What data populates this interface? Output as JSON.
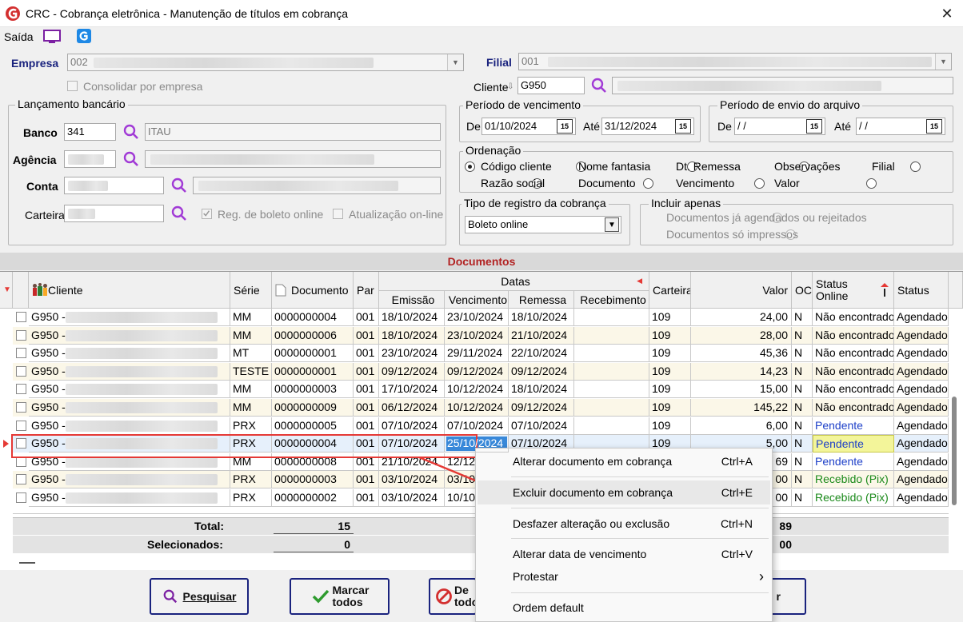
{
  "window": {
    "title": "CRC - Cobrança eletrônica - Manutenção de títulos em cobrança",
    "close": "✕"
  },
  "menu": {
    "saida": "Saída"
  },
  "empresa": {
    "label": "Empresa",
    "code": "002",
    "consolidar": "Consolidar por empresa"
  },
  "filial": {
    "label": "Filial",
    "code": "001"
  },
  "cliente": {
    "label": "Cliente",
    "code": "G950"
  },
  "lancamento": {
    "title": "Lançamento bancário",
    "banco_label": "Banco",
    "banco": "341",
    "banco_nome": "ITAU",
    "agencia_label": "Agência",
    "conta_label": "Conta",
    "carteira_label": "Carteira",
    "reg_boleto": "Reg. de boleto online",
    "atualizacao": "Atualização on-line"
  },
  "vencimento": {
    "title": "Período de vencimento",
    "de_label": "De",
    "de": "01/10/2024",
    "ate_label": "Até",
    "ate": "31/12/2024"
  },
  "envio": {
    "title": "Período de envio do arquivo",
    "de_label": "De",
    "de": " / /",
    "ate_label": "Até",
    "ate": " / /"
  },
  "ordenacao": {
    "title": "Ordenação",
    "opts": [
      "Código cliente",
      "Nome fantasia",
      "Dt. Remessa",
      "Observações",
      "Filial",
      "Razão social",
      "Documento",
      "Vencimento",
      "Valor"
    ]
  },
  "tipo": {
    "title": "Tipo de registro da cobrança",
    "value": "Boleto online"
  },
  "incluir": {
    "title": "Incluir apenas",
    "opt1": "Documentos já agendados ou rejeitados",
    "opt2": "Documentos só impressos"
  },
  "documentos": {
    "title": "Documentos"
  },
  "grid": {
    "h_cliente": "Cliente",
    "h_serie": "Série",
    "h_documento": "Documento",
    "h_par": "Par",
    "h_datas": "Datas",
    "h_emissao": "Emissão",
    "h_vencimento": "Vencimento",
    "h_remessa": "Remessa",
    "h_recebimento": "Recebimento",
    "h_carteira": "Carteira",
    "h_valor": "Valor",
    "h_oc": "OC",
    "h_status_online": "Status Online",
    "h_status": "Status",
    "rows": [
      {
        "cliente": "G950 -",
        "serie": "MM",
        "doc": "0000000004",
        "par": "001",
        "emissao": "18/10/2024",
        "venc": "23/10/2024",
        "remessa": "18/10/2024",
        "receb": "",
        "carteira": "109",
        "valor": "24,00",
        "oc": "N",
        "status_online": "Não encontrado",
        "status": "Agendado"
      },
      {
        "cliente": "G950 -",
        "serie": "MM",
        "doc": "0000000006",
        "par": "001",
        "emissao": "18/10/2024",
        "venc": "23/10/2024",
        "remessa": "21/10/2024",
        "receb": "",
        "carteira": "109",
        "valor": "28,00",
        "oc": "N",
        "status_online": "Não encontrado",
        "status": "Agendado"
      },
      {
        "cliente": "G950 -",
        "serie": "MT",
        "doc": "0000000001",
        "par": "001",
        "emissao": "23/10/2024",
        "venc": "29/11/2024",
        "remessa": "22/10/2024",
        "receb": "",
        "carteira": "109",
        "valor": "45,36",
        "oc": "N",
        "status_online": "Não encontrado",
        "status": "Agendado"
      },
      {
        "cliente": "G950 -",
        "serie": "TESTE",
        "doc": "0000000001",
        "par": "001",
        "emissao": "09/12/2024",
        "venc": "09/12/2024",
        "remessa": "09/12/2024",
        "receb": "",
        "carteira": "109",
        "valor": "14,23",
        "oc": "N",
        "status_online": "Não encontrado",
        "status": "Agendado"
      },
      {
        "cliente": "G950 -",
        "serie": "MM",
        "doc": "0000000003",
        "par": "001",
        "emissao": "17/10/2024",
        "venc": "10/12/2024",
        "remessa": "18/10/2024",
        "receb": "",
        "carteira": "109",
        "valor": "15,00",
        "oc": "N",
        "status_online": "Não encontrado",
        "status": "Agendado"
      },
      {
        "cliente": "G950 -",
        "serie": "MM",
        "doc": "0000000009",
        "par": "001",
        "emissao": "06/12/2024",
        "venc": "10/12/2024",
        "remessa": "09/12/2024",
        "receb": "",
        "carteira": "109",
        "valor": "145,22",
        "oc": "N",
        "status_online": "Não encontrado",
        "status": "Agendado"
      },
      {
        "cliente": "G950 -",
        "serie": "PRX",
        "doc": "0000000005",
        "par": "001",
        "emissao": "07/10/2024",
        "venc": "07/10/2024",
        "remessa": "07/10/2024",
        "receb": "",
        "carteira": "109",
        "valor": "6,00",
        "oc": "N",
        "status_online": "Pendente",
        "status": "Agendado"
      },
      {
        "cliente": "G950 -",
        "serie": "PRX",
        "doc": "0000000004",
        "par": "001",
        "emissao": "07/10/2024",
        "venc": "25/10/2024",
        "remessa": "07/10/2024",
        "receb": "",
        "carteira": "109",
        "valor": "5,00",
        "oc": "N",
        "status_online": "Pendente",
        "status": "Agendado"
      },
      {
        "cliente": "G950 -",
        "serie": "MM",
        "doc": "0000000008",
        "par": "001",
        "emissao": "21/10/2024",
        "venc": "12/12",
        "remessa": "",
        "receb": "",
        "carteira": "",
        "valor": "69",
        "oc": "N",
        "status_online": "Pendente",
        "status": "Agendado"
      },
      {
        "cliente": "G950 -",
        "serie": "PRX",
        "doc": "0000000003",
        "par": "001",
        "emissao": "03/10/2024",
        "venc": "03/10",
        "remessa": "",
        "receb": "",
        "carteira": "",
        "valor": "00",
        "oc": "N",
        "status_online": "Recebido (Pix)",
        "status": "Agendado"
      },
      {
        "cliente": "G950 -",
        "serie": "PRX",
        "doc": "0000000002",
        "par": "001",
        "emissao": "03/10/2024",
        "venc": "10/10",
        "remessa": "",
        "receb": "",
        "carteira": "",
        "valor": "00",
        "oc": "N",
        "status_online": "Recebido (Pix)",
        "status": "Agendado"
      }
    ],
    "total_label": "Total:",
    "total": "15",
    "total_valor": "89",
    "selecionados_label": "Selecionados:",
    "selecionados": "0",
    "sel_valor": "00"
  },
  "buttons": {
    "pesquisar": "Pesquisar",
    "marcar": "Marcar todos",
    "desmarcar": "De todo",
    "r": "r"
  },
  "context_menu": {
    "alterar": "Alterar documento em cobrança",
    "alterar_sc": "Ctrl+A",
    "excluir": "Excluir documento em cobrança",
    "excluir_sc": "Ctrl+E",
    "desfazer": "Desfazer alteração ou exclusão",
    "desfazer_sc": "Ctrl+N",
    "alterar_data": "Alterar data de vencimento",
    "alterar_data_sc": "Ctrl+V",
    "protestar": "Protestar",
    "protestar_arrow": "›",
    "ordem": "Ordem default"
  },
  "colors": {
    "accent": "#1a237e",
    "red": "#e53935",
    "pending": "#1e40c8",
    "received": "#1b8a1b"
  }
}
